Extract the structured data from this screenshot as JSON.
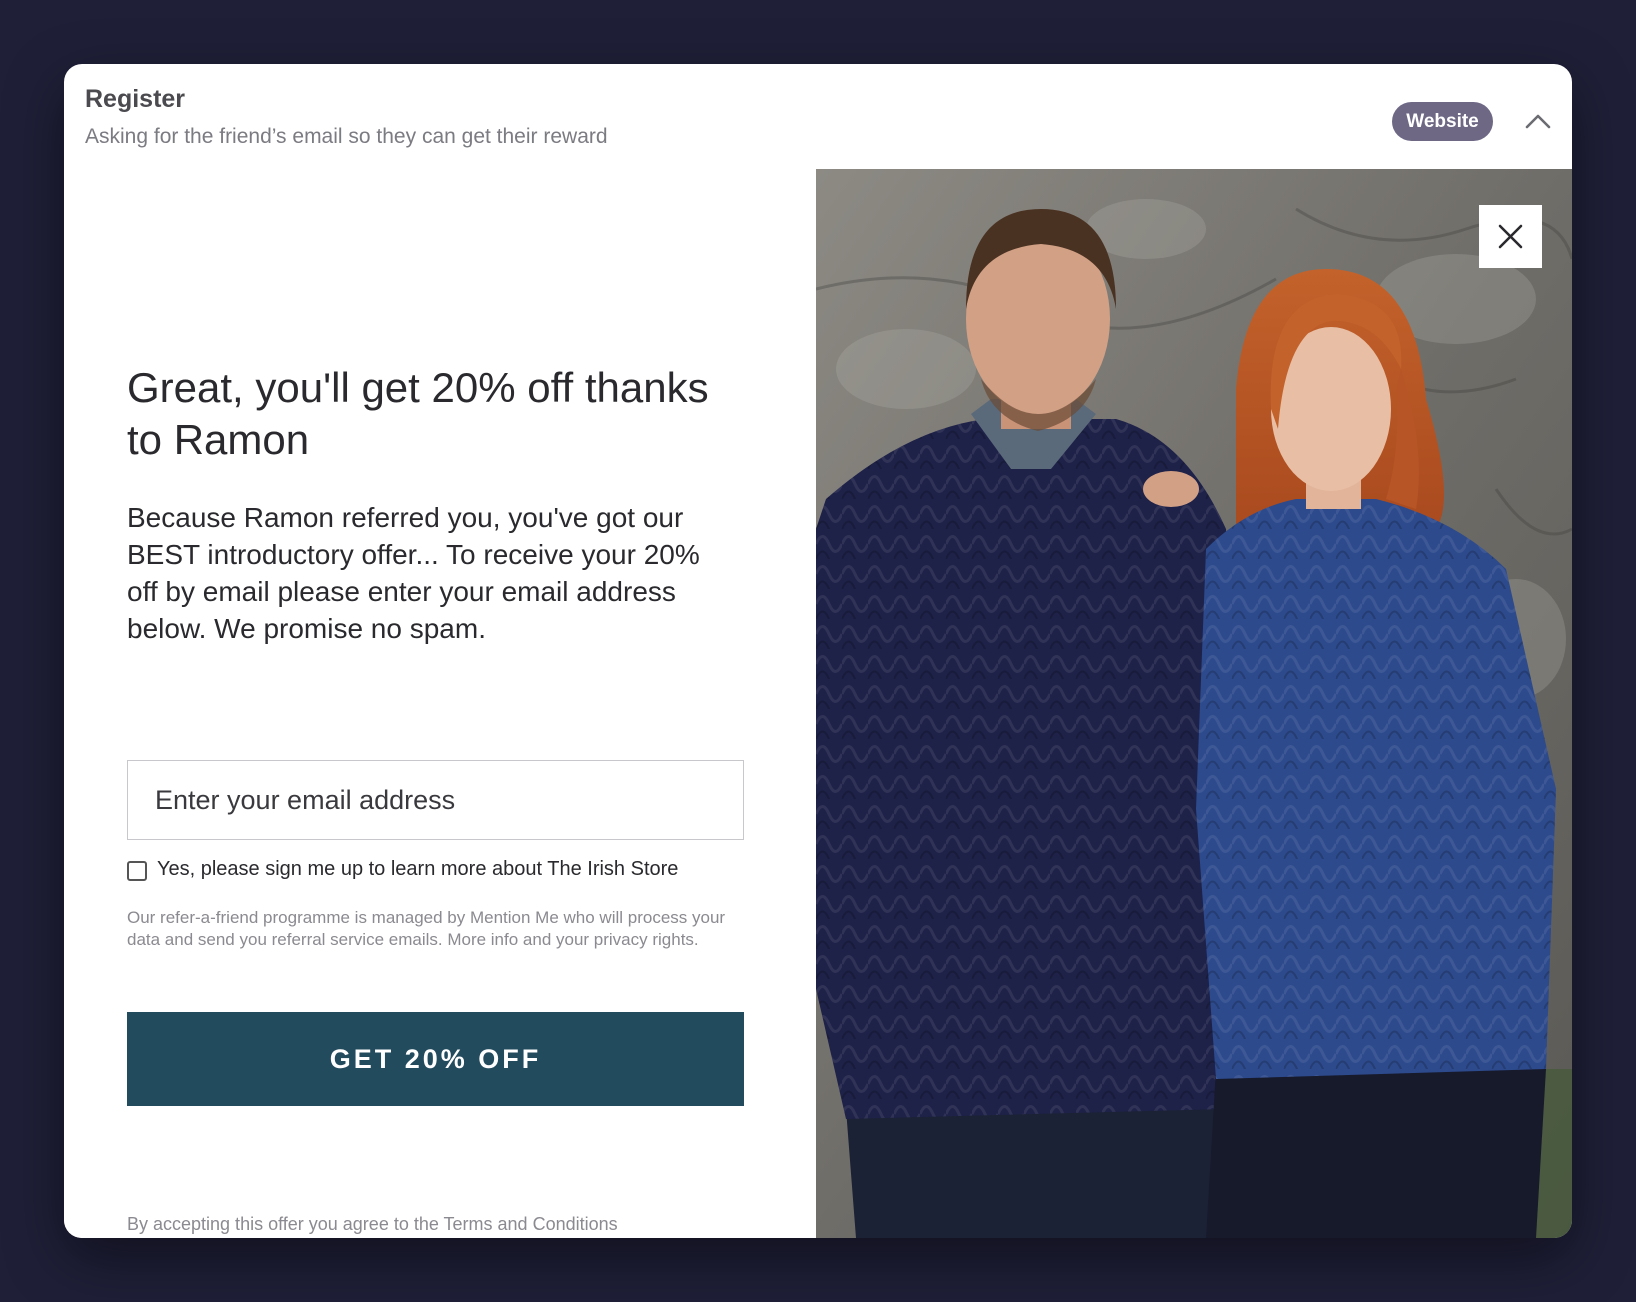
{
  "card": {
    "title": "Register",
    "subtitle": "Asking for the friend’s email so they can get their reward",
    "badge": "Website",
    "collapse_icon": "chevron-up-icon"
  },
  "promo": {
    "headline": "Great, you'll get 20% off thanks to Ramon",
    "body": "Because Ramon referred you, you've got our BEST introductory offer... To receive your 20% off by email please enter your email address below. We promise no spam.",
    "email_placeholder": "Enter your email address",
    "email_value": "",
    "checkbox_label": "Yes, please sign me up to learn more about The Irish Store",
    "checkbox_checked": false,
    "privacy": "Our refer-a-friend programme is managed by Mention Me who will process your data and send you referral service emails. More info and your privacy rights.",
    "cta_label": "GET 20% OFF",
    "terms": "By accepting this offer you agree to the Terms and Conditions",
    "close_icon": "close-icon"
  },
  "colors": {
    "page_background": "#1f1f38",
    "badge": "#6e6885",
    "cta": "#224b5e",
    "sweater_man": "#1e2148",
    "sweater_woman": "#2d4a8c"
  }
}
